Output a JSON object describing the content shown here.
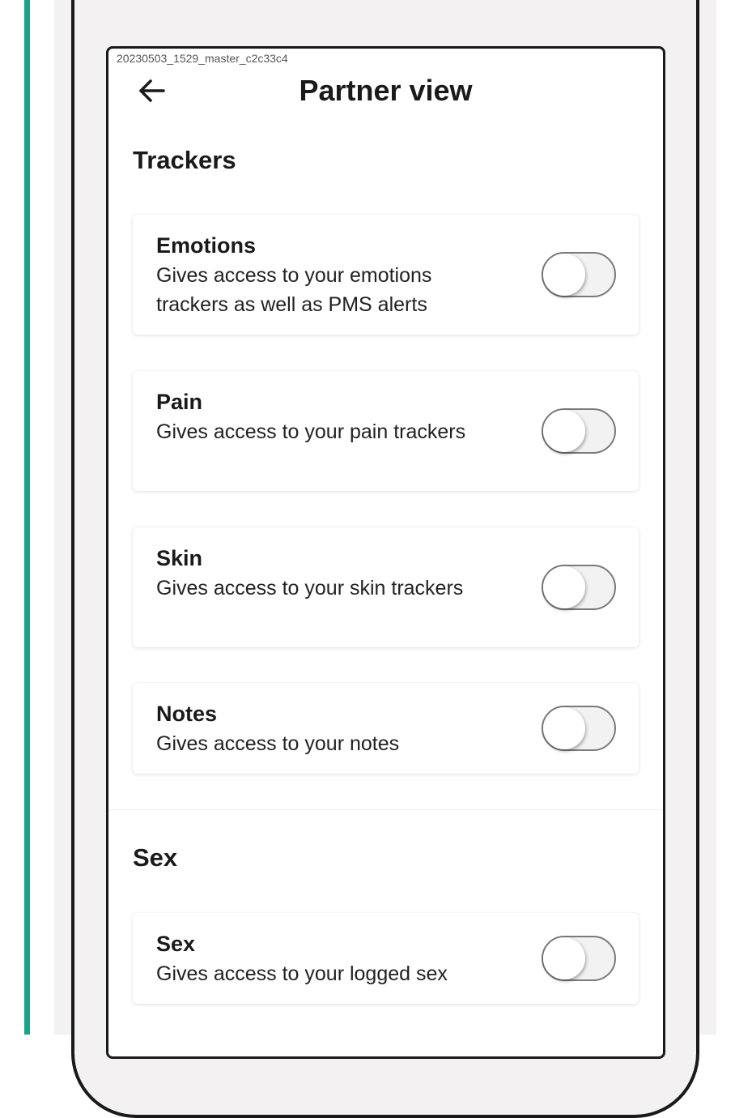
{
  "build_tag": "20230503_1529_master_c2c33c4",
  "header": {
    "title": "Partner view"
  },
  "sections": [
    {
      "title": "Trackers",
      "items": [
        {
          "title": "Emotions",
          "description": "Gives access to your emotions trackers as well as PMS alerts",
          "enabled": false
        },
        {
          "title": "Pain",
          "description": "Gives access to your pain trackers",
          "enabled": false
        },
        {
          "title": "Skin",
          "description": "Gives access to your skin trackers",
          "enabled": false
        },
        {
          "title": "Notes",
          "description": "Gives access to your notes",
          "enabled": false
        }
      ]
    },
    {
      "title": "Sex",
      "items": [
        {
          "title": "Sex",
          "description": "Gives access to your logged sex",
          "enabled": false
        }
      ]
    }
  ],
  "colors": {
    "accent": "#1aa38a",
    "frame": "#f3f1f1",
    "toggle_off_track": "#f2f2f2",
    "toggle_border": "#7a7a7a"
  },
  "icons": {
    "back": "arrow-left-icon"
  }
}
